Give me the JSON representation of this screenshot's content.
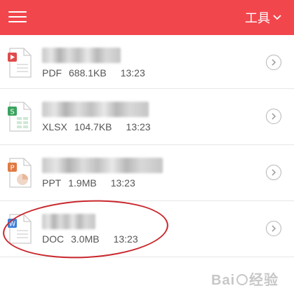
{
  "header": {
    "background": "#f2464d",
    "tools_label": "工具"
  },
  "files": [
    {
      "type": "PDF",
      "size": "688.1KB",
      "time": "13:23",
      "icon": "pdf-file-icon",
      "accent": "#e04b4b",
      "badge": "▶",
      "name_width": 112
    },
    {
      "type": "XLSX",
      "size": "104.7KB",
      "time": "13:23",
      "icon": "xlsx-file-icon",
      "accent": "#3aa45e",
      "badge": "S",
      "name_width": 152
    },
    {
      "type": "PPT",
      "size": "1.9MB",
      "time": "13:23",
      "icon": "ppt-file-icon",
      "accent": "#e07a42",
      "badge": "P",
      "name_width": 172
    },
    {
      "type": "DOC",
      "size": "3.0MB",
      "time": "13:23",
      "icon": "doc-file-icon",
      "accent": "#3c7fd8",
      "badge": "W",
      "name_width": 76
    }
  ],
  "highlight_color": "#c9282e"
}
